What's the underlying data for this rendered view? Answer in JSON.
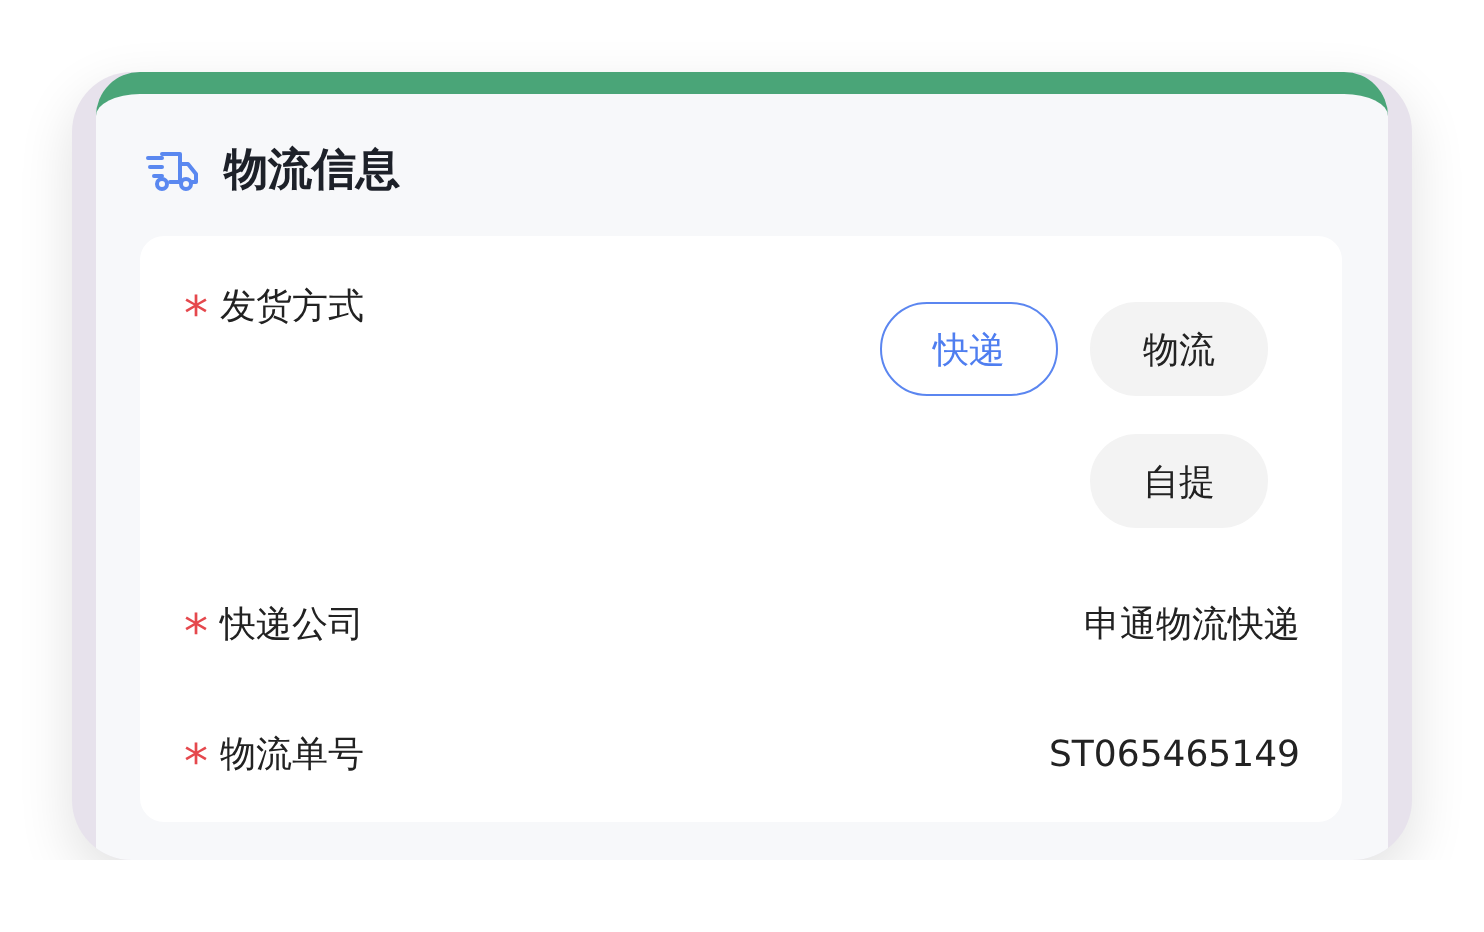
{
  "section": {
    "title": "物流信息"
  },
  "fields": [
    {
      "kind": "choice",
      "marker": "*",
      "label": "发货方式",
      "options": [
        {
          "label": "快递",
          "selected": true
        },
        {
          "label": "物流",
          "selected": false
        },
        {
          "label": "自提",
          "selected": false
        }
      ]
    },
    {
      "kind": "text",
      "marker": "*",
      "label": "快递公司",
      "value": "申通物流快递"
    },
    {
      "kind": "text",
      "marker": "*",
      "label": "物流单号",
      "value": "ST065465149"
    }
  ]
}
